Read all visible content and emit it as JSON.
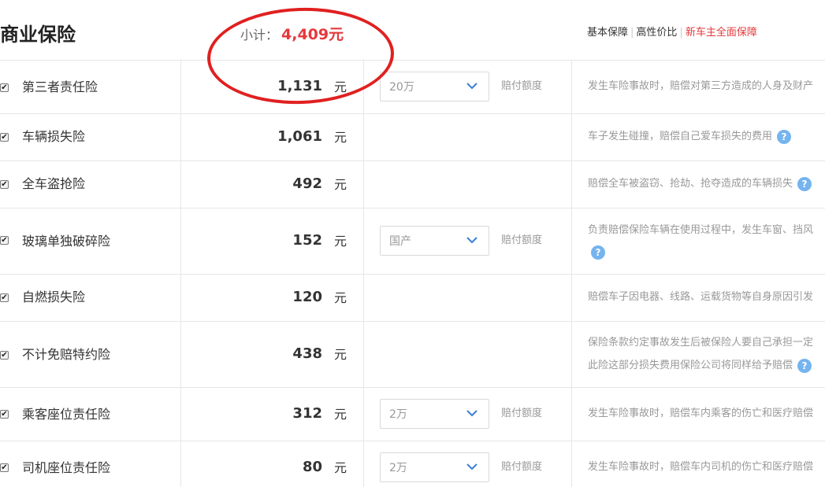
{
  "header": {
    "title": "商业保险",
    "subtotal_label": "小计：",
    "subtotal_value": "4,409元",
    "tabs": [
      "基本保障",
      "高性价比",
      "新车主全面保障"
    ],
    "tab_separator": "|"
  },
  "colors": {
    "accent_red": "#e4393c",
    "help_blue": "#74b4ef"
  },
  "rows": [
    {
      "name": "第三者责任险",
      "price": "1,131",
      "unit": "元",
      "select": "20万",
      "option_label": "赔付额度",
      "desc": "发生车险事故时，赔偿对第三方造成的人身及财产"
    },
    {
      "name": "车辆损失险",
      "price": "1,061",
      "unit": "元",
      "desc": "车子发生碰撞，赔偿自己爱车损失的费用",
      "help": "?"
    },
    {
      "name": "全车盗抢险",
      "price": "492",
      "unit": "元",
      "desc": "赔偿全车被盗窃、抢劫、抢夺造成的车辆损失",
      "help": "?"
    },
    {
      "name": "玻璃单独破碎险",
      "price": "152",
      "unit": "元",
      "select": "国产",
      "option_label": "赔付额度",
      "desc": "负责赔偿保险车辆在使用过程中，发生车窗、挡风",
      "help": "?"
    },
    {
      "name": "自燃损失险",
      "price": "120",
      "unit": "元",
      "desc": "赔偿车子因电器、线路、运载货物等自身原因引发"
    },
    {
      "name": "不计免赔特约险",
      "price": "438",
      "unit": "元",
      "desc": "保险条款约定事故发生后被保险人要自己承担一定",
      "desc2": "此险这部分损失费用保险公司将同样给予赔偿",
      "help": "?"
    },
    {
      "name": "乘客座位责任险",
      "price": "312",
      "unit": "元",
      "select": "2万",
      "option_label": "赔付额度",
      "desc": "发生车险事故时，赔偿车内乘客的伤亡和医疗赔偿"
    },
    {
      "name": "司机座位责任险",
      "price": "80",
      "unit": "元",
      "select": "2万",
      "option_label": "赔付额度",
      "desc": "发生车险事故时，赔偿车内司机的伤亡和医疗赔偿"
    }
  ]
}
